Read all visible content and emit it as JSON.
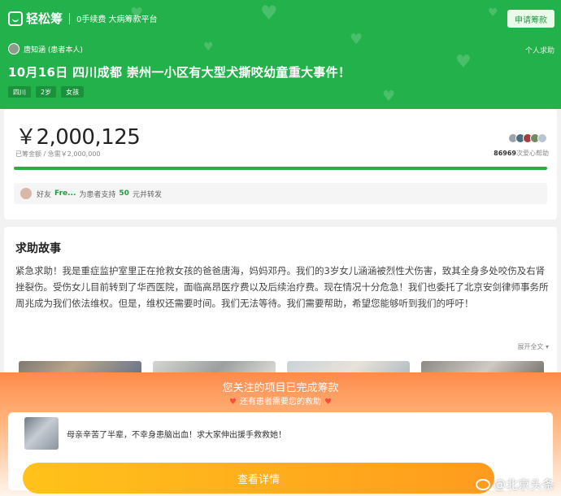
{
  "header": {
    "logo_text": "轻松筹",
    "slogan": "0手续费  大病筹款平台",
    "apply_button": "申请筹款",
    "author": "唐知涵 (患者本人)",
    "personal_label": "个人求助",
    "title": "10月16日 四川成都 崇州一小区有大型犬撕咬幼童重大事件！",
    "tags": [
      "四川",
      "2岁",
      "女孩"
    ],
    "bg_color": "#22b14a"
  },
  "fundraise": {
    "amount": "￥2,000,125",
    "raised_label": "已筹金额 /  急需￥2,000,000",
    "help_count": "86969",
    "help_suffix": "次爱心帮助",
    "progress": 1.0,
    "share_prefix": "好友",
    "share_user": "Fre...",
    "share_mid": "为患者支持",
    "share_amount": "50",
    "share_suffix": "元并转发"
  },
  "story": {
    "title": "求助故事",
    "text": "紧急求助！我是重症监护室里正在抢救女孩的爸爸唐海，妈妈邓丹。我们的3岁女儿涵涵被烈性犬伤害，致其全身多处咬伤及右肾挫裂伤。受伤女儿目前转到了华西医院，面临高昂医疗费以及后续治疗费。现在情况十分危急！我们也委托了北京安剑律师事务所周兆成为我们依法维权。但是，维权还需要时间。我们无法等待。我们需要帮助，希望您能够听到我们的呼吁！",
    "expand_label": "展开全文 ▾"
  },
  "overlay": {
    "title": "您关注的项目已完成筹款",
    "subtitle": "还有患者需要您的救助",
    "recommend_text": "母亲辛苦了半辈，不幸身患脑出血！求大家伸出援手救救她！",
    "button_label": "查看详情"
  },
  "watermark": "@北京头条"
}
